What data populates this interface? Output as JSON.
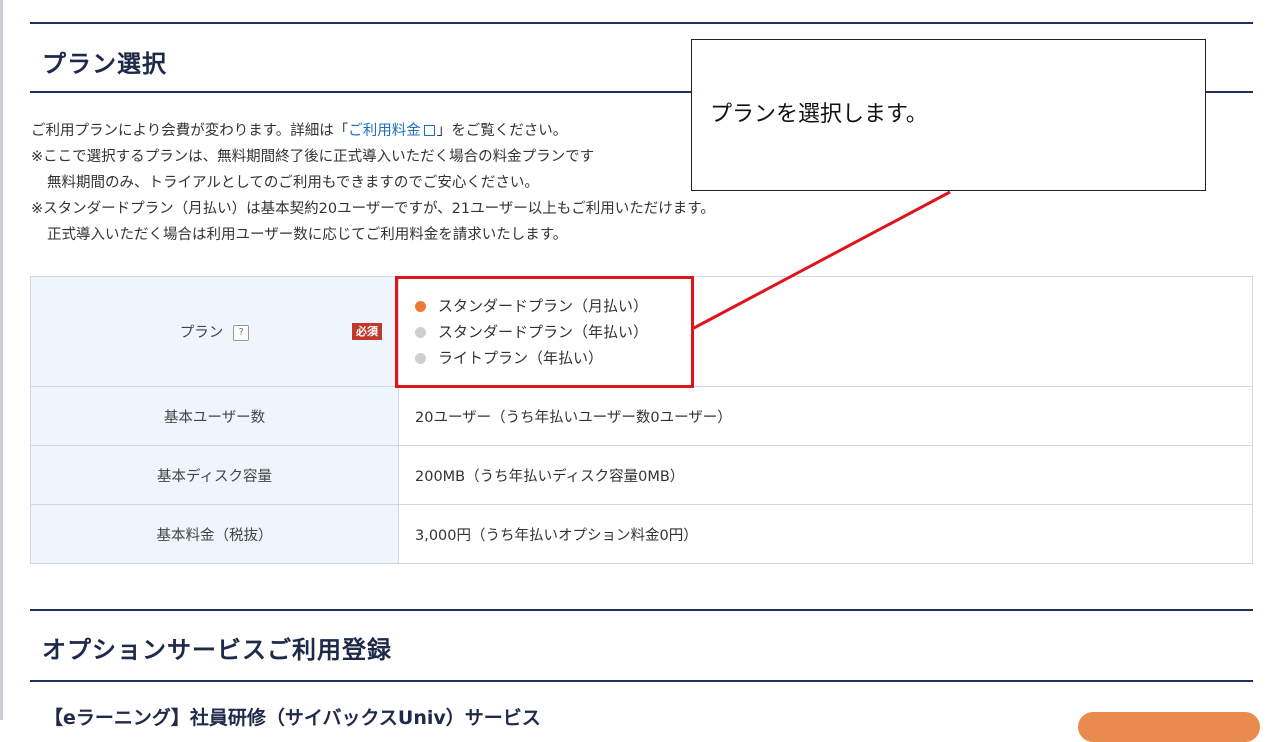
{
  "plan_section": {
    "title": "プラン選択",
    "description": {
      "line1_prefix": "ご利用プランにより会費が変わります。詳細は「",
      "line1_link": "ご利用料金",
      "line1_suffix": "」をご覧ください。",
      "line2": "※ここで選択するプランは、無料期間終了後に正式導入いただく場合の料金プランです",
      "line3": "無料期間のみ、トライアルとしてのご利用もできますのでご安心ください。",
      "line4": "※スタンダードプラン（月払い）は基本契約20ユーザーですが、21ユーザー以上もご利用いただけます。",
      "line5": "正式導入いただく場合は利用ユーザー数に応じてご利用料金を請求いたします。"
    },
    "table": {
      "plan_label": "プラン",
      "help_icon_text": "?",
      "required_badge": "必須",
      "plan_options": [
        {
          "label": "スタンダードプラン（月払い）",
          "selected": true
        },
        {
          "label": "スタンダードプラン（年払い）",
          "selected": false
        },
        {
          "label": "ライトプラン（年払い）",
          "selected": false
        }
      ],
      "users_label": "基本ユーザー数",
      "users_value": "20ユーザー（うち年払いユーザー数0ユーザー）",
      "disk_label": "基本ディスク容量",
      "disk_value": "200MB（うち年払いディスク容量0MB）",
      "fee_label": "基本料金（税抜）",
      "fee_value": "3,000円（うち年払いオプション料金0円）"
    }
  },
  "callout": {
    "text": "プランを選択します。"
  },
  "options_section": {
    "title": "オプションサービスご利用登録",
    "subsection_title": "【eラーニング】社員研修（サイバックスUniv）サービス"
  },
  "colors": {
    "accent_orange": "#ec7a35",
    "highlight_red": "#e0141c",
    "heading_navy": "#1f2a4a",
    "required_red": "#c0392b",
    "table_header_bg": "#eef5fd"
  }
}
